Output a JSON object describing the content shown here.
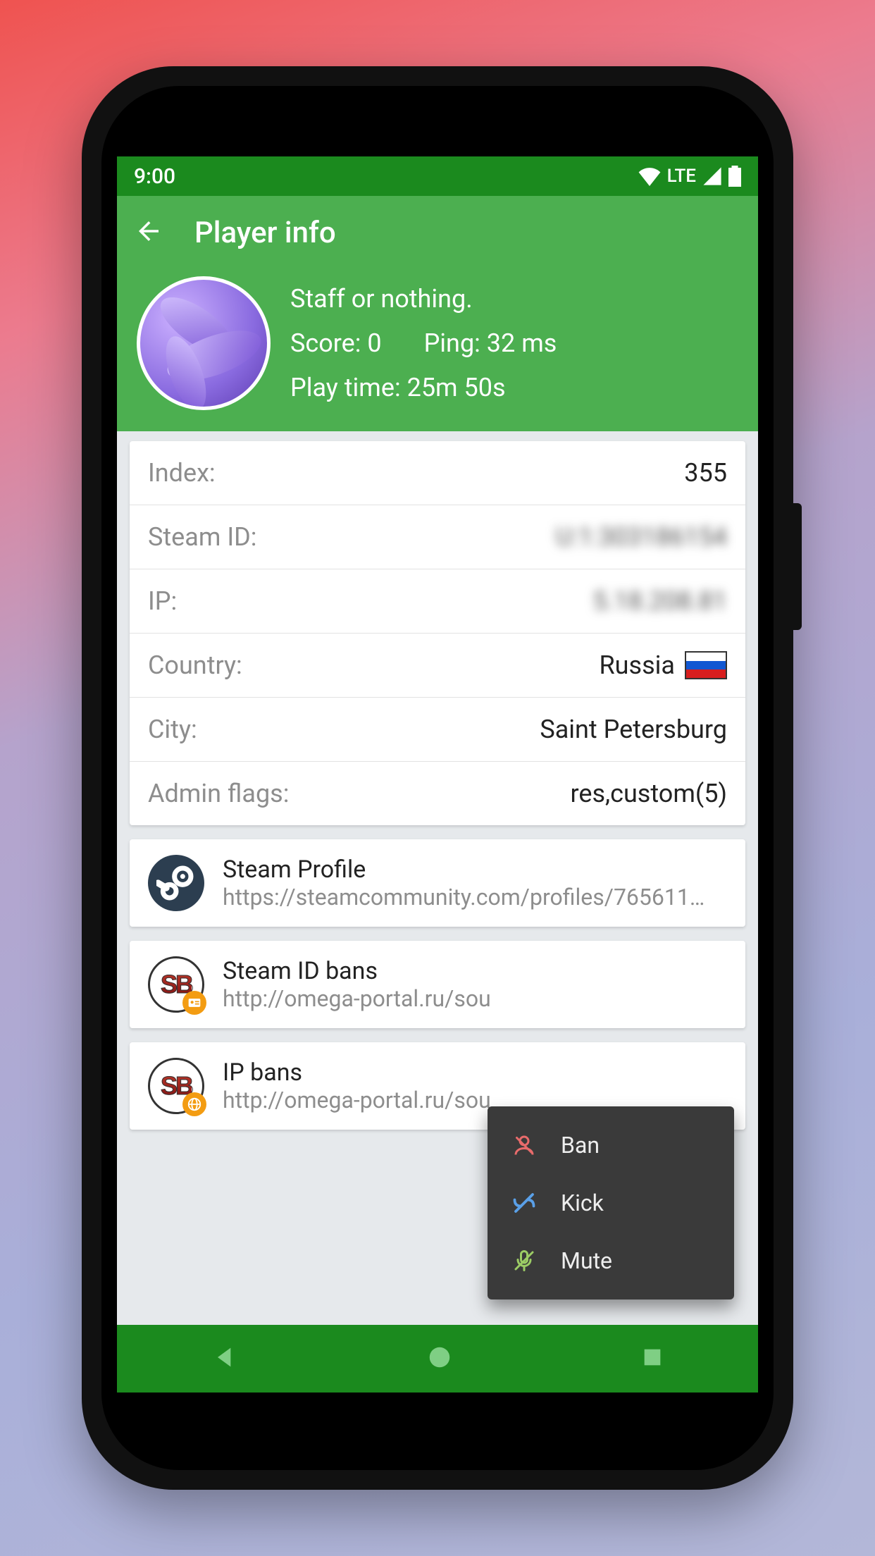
{
  "status": {
    "time": "9:00",
    "network": "LTE"
  },
  "appbar": {
    "title": "Player info"
  },
  "player": {
    "name": "Staff or nothing.",
    "score_label": "Score: 0",
    "ping_label": "Ping: 32 ms",
    "playtime_label": "Play time: 25m 50s"
  },
  "details": [
    {
      "label": "Index:",
      "value": "355",
      "blurred": false,
      "flag": false
    },
    {
      "label": "Steam ID:",
      "value": "U:1:303186154",
      "blurred": true,
      "flag": false
    },
    {
      "label": "IP:",
      "value": "5.18.208.81",
      "blurred": true,
      "flag": false
    },
    {
      "label": "Country:",
      "value": "Russia",
      "blurred": false,
      "flag": true
    },
    {
      "label": "City:",
      "value": "Saint Petersburg",
      "blurred": false,
      "flag": false
    },
    {
      "label": "Admin flags:",
      "value": "res,custom(5)",
      "blurred": false,
      "flag": false
    }
  ],
  "links": {
    "steam_profile": {
      "title": "Steam Profile",
      "url": "https://steamcommunity.com/profiles/765611…"
    },
    "steam_bans": {
      "title": "Steam ID bans",
      "url": "http://omega-portal.ru/sou"
    },
    "ip_bans": {
      "title": "IP bans",
      "url": "http://omega-portal.ru/sou"
    }
  },
  "menu": {
    "ban": "Ban",
    "kick": "Kick",
    "mute": "Mute"
  }
}
